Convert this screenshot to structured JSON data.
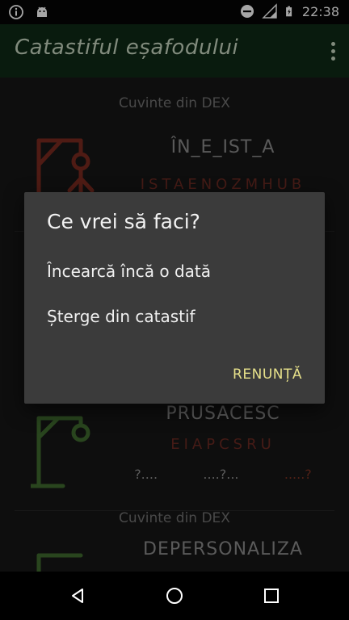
{
  "status_bar": {
    "time": "22:38",
    "left_icons": [
      "info-icon",
      "android-icon"
    ],
    "right_icons": [
      "do-not-disturb-icon",
      "signal-icon",
      "battery-icon"
    ]
  },
  "app_bar": {
    "title": "Catastiful eșafodului",
    "overflow_icon": "more-vert-icon",
    "background": "#0e2a16"
  },
  "list": [
    {
      "source": "Cuvinte din DEX",
      "word": "ÎN_E_IST_A",
      "letters": "ISTAENOZMHUB",
      "gallows_color": "#7a2a20"
    },
    {
      "source": "",
      "word": "PRUSACESC",
      "letters": "EIAPCSRU",
      "hints": [
        "?....",
        "....?...",
        ".....?"
      ],
      "gallows_color": "#3f6b2e"
    },
    {
      "source": "Cuvinte din DEX",
      "word": "DEPERSONALIZA",
      "gallows_color": "#3f6b2e"
    }
  ],
  "dialog": {
    "title": "Ce vrei să faci?",
    "options": [
      "Încearcă încă o dată",
      "Șterge din catastif"
    ],
    "cancel_label": "RENUNȚĂ",
    "accent": "#e6e08a"
  },
  "nav_bar": {
    "buttons": [
      "back-icon",
      "home-icon",
      "recents-icon"
    ]
  }
}
